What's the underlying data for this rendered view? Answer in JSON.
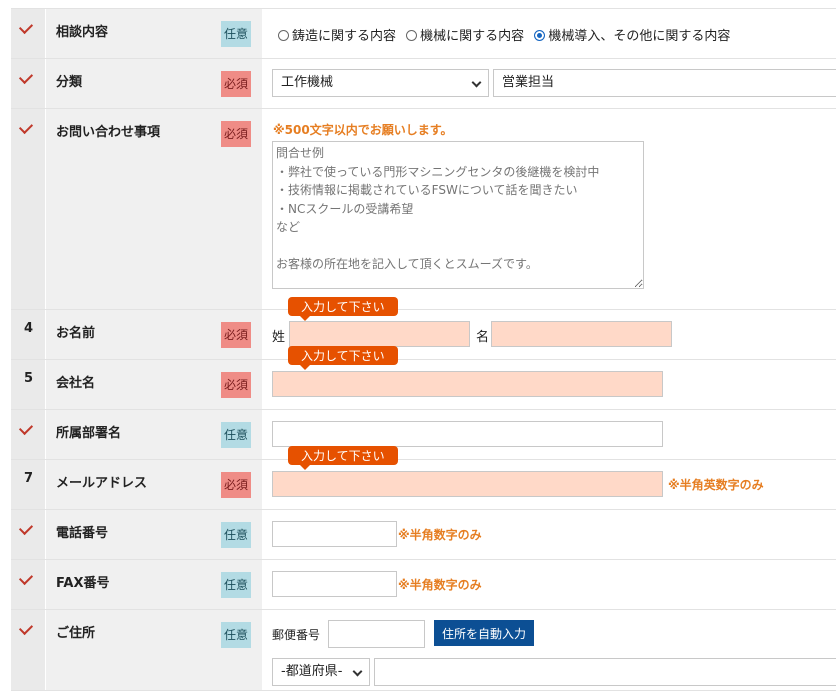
{
  "rows": {
    "consult": {
      "label": "相談内容",
      "badge": "任意",
      "options": [
        "鋳造に関する内容",
        "機械に関する内容",
        "機械導入、その他に関する内容"
      ]
    },
    "category": {
      "label": "分類",
      "badge": "必須",
      "select1": "工作機械",
      "select2": "営業担当"
    },
    "inquiry": {
      "label": "お問い合わせ事項",
      "badge": "必須",
      "note": "※500文字以内でお願いします。",
      "placeholder": "問合せ例\n・弊社で使っている門形マシニングセンタの後継機を検討中\n・技術情報に掲載されているFSWについて話を聞きたい\n・NCスクールの受講希望\nなど\n\nお客様の所在地を記入して頂くとスムーズです。"
    },
    "name": {
      "num": "4",
      "label": "お名前",
      "badge": "必須",
      "last": "姓",
      "first": "名",
      "tip": "入力して下さい"
    },
    "company": {
      "num": "5",
      "label": "会社名",
      "badge": "必須",
      "tip": "入力して下さい"
    },
    "dept": {
      "label": "所属部署名",
      "badge": "任意"
    },
    "email": {
      "num": "7",
      "label": "メールアドレス",
      "badge": "必須",
      "tip": "入力して下さい",
      "note": "※半角英数字のみ"
    },
    "phone": {
      "label": "電話番号",
      "badge": "任意",
      "note": "※半角数字のみ"
    },
    "fax": {
      "label": "FAX番号",
      "badge": "任意",
      "note": "※半角数字のみ"
    },
    "address": {
      "label": "ご住所",
      "badge": "任意",
      "zip_label": "郵便番号",
      "auto_button": "住所を自動入力",
      "pref": "-都道府県-"
    }
  },
  "colors": {
    "required": "#ef8c86",
    "optional": "#b3dbe4",
    "error_field": "#ffd9c8",
    "tip": "#e65100",
    "note": "#e67e22",
    "button": "#0c4f94"
  }
}
